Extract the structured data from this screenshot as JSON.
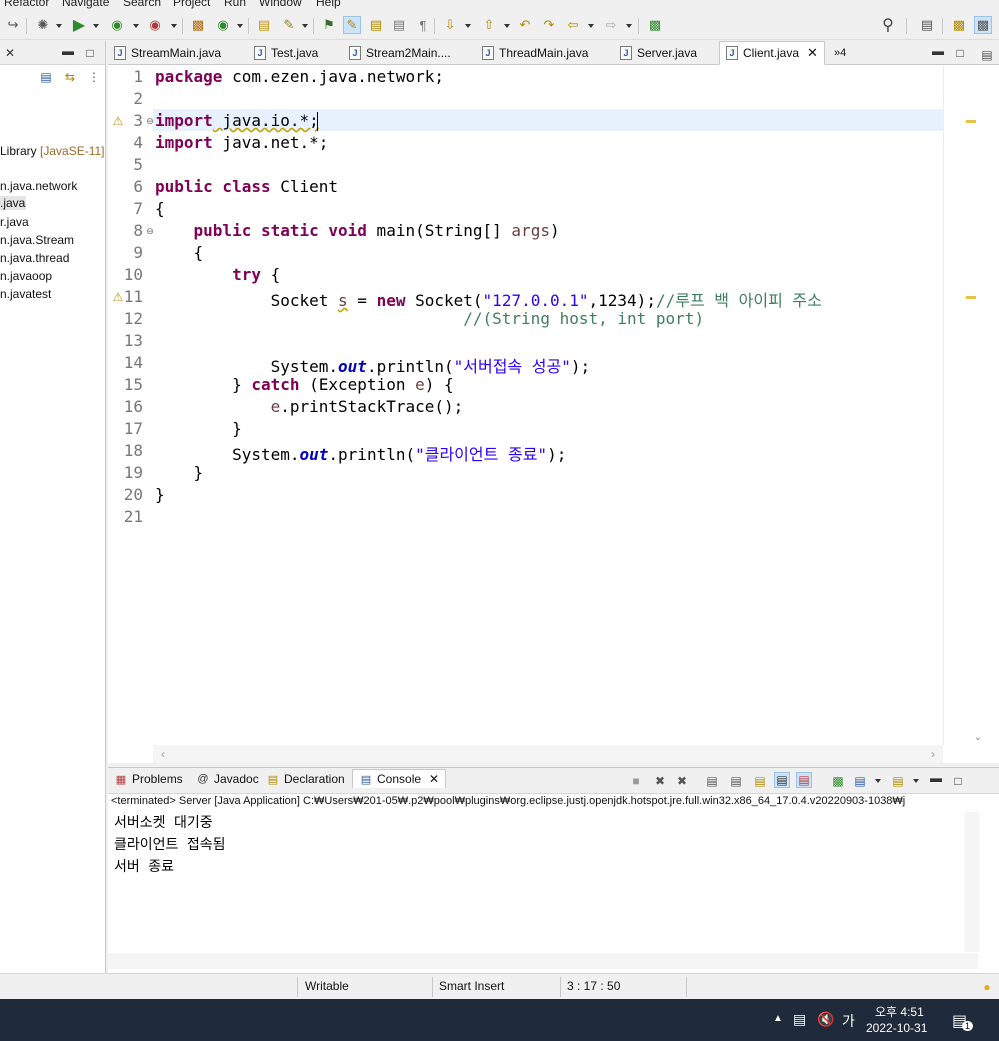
{
  "menu": [
    "Refactor",
    "Navigate",
    "Search",
    "Project",
    "Run",
    "Window",
    "Help"
  ],
  "explorer": {
    "lines": [
      {
        "text": "Library ",
        "suffix": "[JavaSE-11]"
      },
      {
        "text": "n.java.network",
        "suffix": ""
      },
      {
        "text": ".java",
        "suffix": ""
      },
      {
        "text": "r.java",
        "suffix": ""
      },
      {
        "text": "n.java.Stream",
        "suffix": ""
      },
      {
        "text": "n.java.thread",
        "suffix": ""
      },
      {
        "text": "n.javaoop",
        "suffix": ""
      },
      {
        "text": "n.javatest",
        "suffix": ""
      }
    ]
  },
  "editor_tabs": [
    {
      "label": "StreamMain.java"
    },
    {
      "label": "Test.java"
    },
    {
      "label": "Stream2Main...."
    },
    {
      "label": "ThreadMain.java"
    },
    {
      "label": "Server.java"
    },
    {
      "label": "Client.java",
      "active": true
    }
  ],
  "overflow_tabs": "»4",
  "code_lines": [
    {
      "n": "1"
    },
    {
      "n": "2"
    },
    {
      "n": "3"
    },
    {
      "n": "4"
    },
    {
      "n": "5"
    },
    {
      "n": "6"
    },
    {
      "n": "7"
    },
    {
      "n": "8"
    },
    {
      "n": "9"
    },
    {
      "n": "10"
    },
    {
      "n": "11"
    },
    {
      "n": "12"
    },
    {
      "n": "13"
    },
    {
      "n": "14"
    },
    {
      "n": "15"
    },
    {
      "n": "16"
    },
    {
      "n": "17"
    },
    {
      "n": "18"
    },
    {
      "n": "19"
    },
    {
      "n": "20"
    },
    {
      "n": "21"
    }
  ],
  "code": {
    "l1_kw": "package",
    "l1_rest": " com.ezen.java.network;",
    "l3_kw": "import",
    "l3_rest": " java.io.*;",
    "l4_kw": "import",
    "l4_rest": " java.net.*;",
    "l6_kw": "public class",
    "l6_rest": " Client",
    "l7": "{",
    "l8_kw": "public static void",
    "l8_rest": " main(String[] ",
    "l8_var": "args",
    "l8_end": ")",
    "l9": "{",
    "l10_kw": "try",
    "l10_rest": " {",
    "l11_a": "Socket ",
    "l11_var": "s",
    "l11_b": " = ",
    "l11_kw": "new",
    "l11_c": " Socket(",
    "l11_str": "\"127.0.0.1\"",
    "l11_d": ",1234);",
    "l11_cmt": "//루프 백 아이피 주소",
    "l12_cmt": "//(String host, int port)",
    "l14_a": "System.",
    "l14_fld": "out",
    "l14_b": ".println(",
    "l14_str": "\"서버접속 성공\"",
    "l14_c": ");",
    "l15_a": "} ",
    "l15_kw": "catch",
    "l15_b": " (Exception ",
    "l15_var": "e",
    "l15_c": ") {",
    "l16_var": "e",
    "l16_rest": ".printStackTrace();",
    "l17": "}",
    "l18_a": "System.",
    "l18_fld": "out",
    "l18_b": ".println(",
    "l18_str": "\"클라이언트 종료\"",
    "l18_c": ");",
    "l19": "}",
    "l20": "}"
  },
  "console": {
    "tabs": [
      {
        "label": "Problems"
      },
      {
        "label": "Javadoc"
      },
      {
        "label": "Declaration"
      },
      {
        "label": "Console",
        "active": true
      }
    ],
    "status": "<terminated> Server [Java Application] C:₩Users₩201-05₩.p2₩pool₩plugins₩org.eclipse.justj.openjdk.hotspot.jre.full.win32.x86_64_17.0.4.v20220903-1038₩j",
    "output": [
      "서버소켓 대기중",
      "클라이언트 접속됨",
      "서버 종료"
    ]
  },
  "statusbar": {
    "writable": "Writable",
    "insert_mode": "Smart Insert",
    "position": "3 : 17 : 50"
  },
  "taskbar": {
    "time": "오후 4:51",
    "date": "2022-10-31",
    "ime": "가",
    "notifications": "1"
  }
}
